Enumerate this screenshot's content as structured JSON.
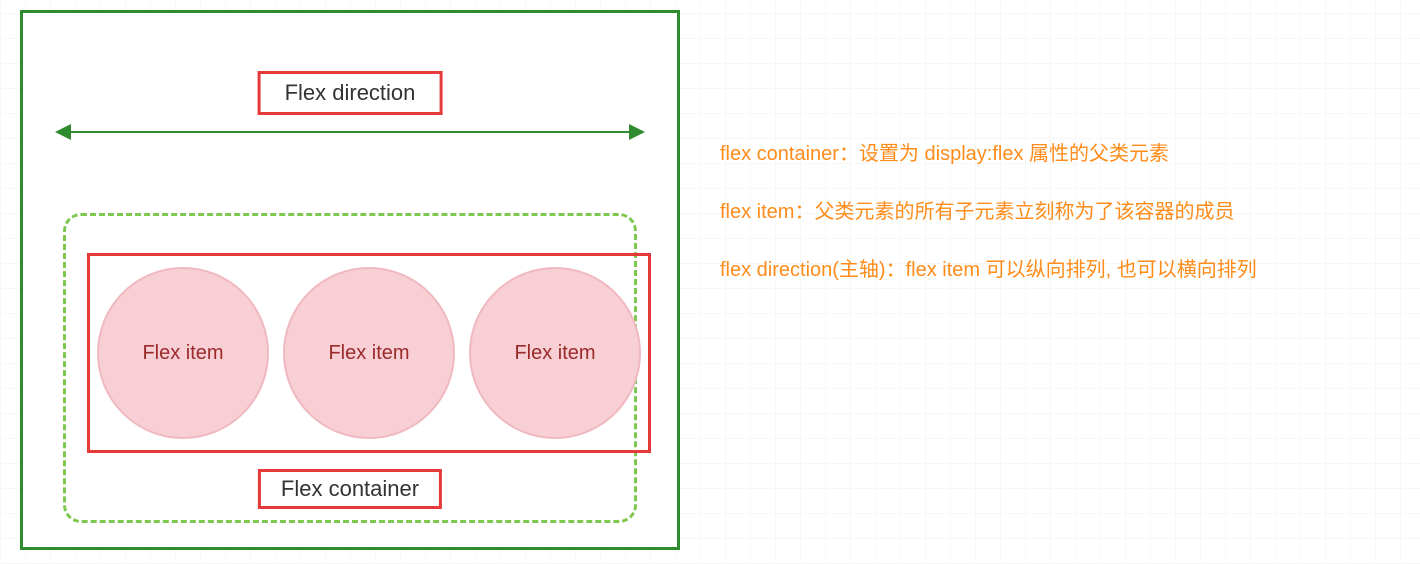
{
  "diagram": {
    "direction_label": "Flex direction",
    "items": [
      "Flex item",
      "Flex item",
      "Flex item"
    ],
    "container_label": "Flex container"
  },
  "notes": {
    "line1": "flex container：设置为 display:flex 属性的父类元素",
    "line2": "flex item：父类元素的所有子元素立刻称为了该容器的成员",
    "line3": "flex direction(主轴)：flex item 可以纵向排列, 也可以横向排列"
  }
}
